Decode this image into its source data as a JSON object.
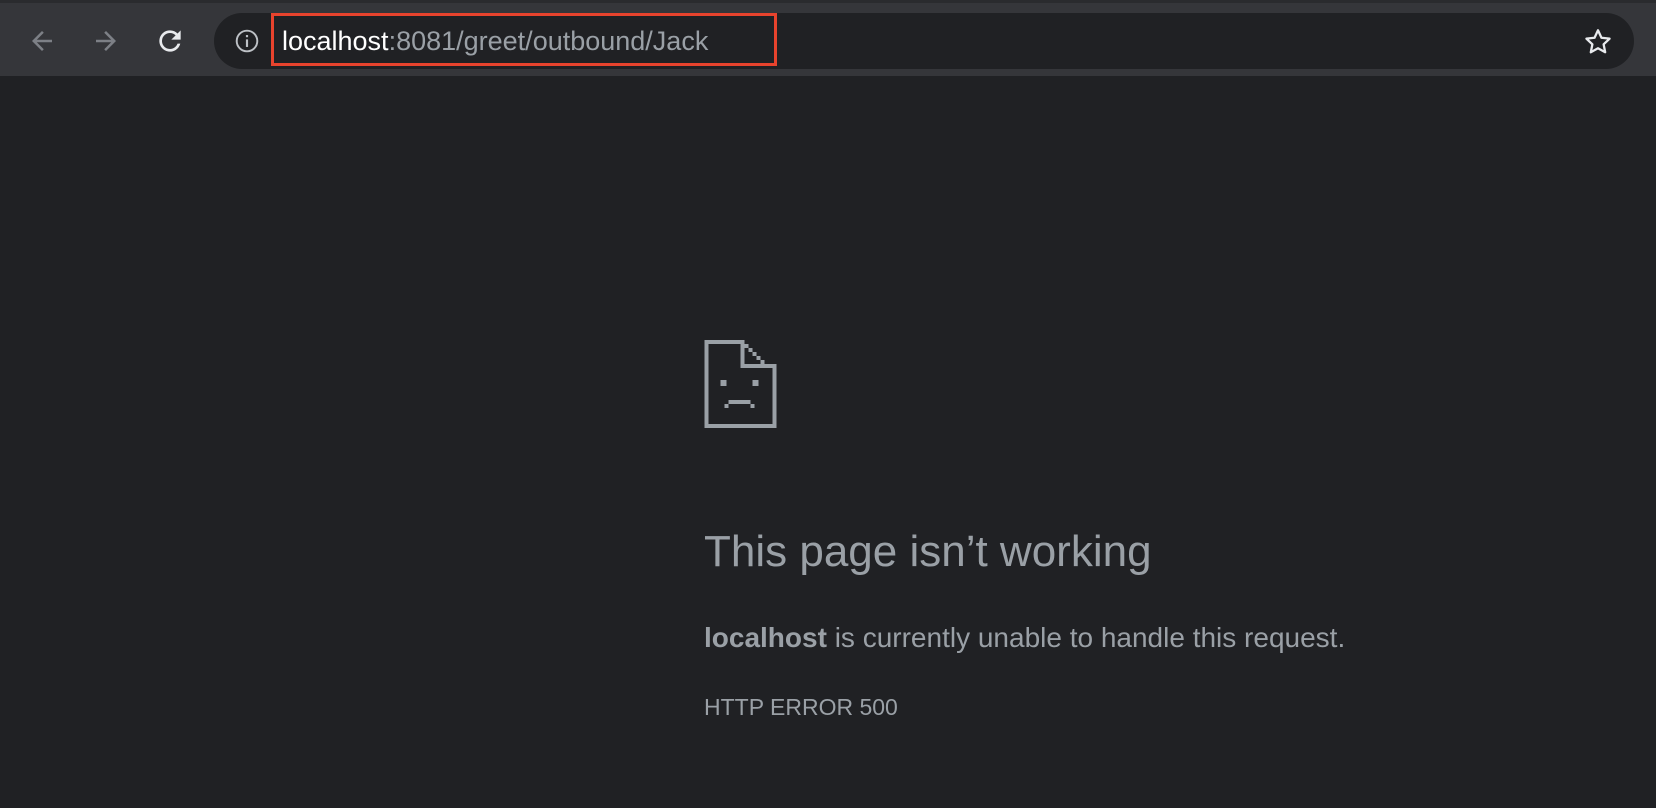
{
  "toolbar": {
    "back_icon": "arrow-left-icon",
    "forward_icon": "arrow-right-icon",
    "reload_icon": "reload-icon",
    "bookmark_icon": "star-icon"
  },
  "omnibox": {
    "site_info_icon": "info-icon",
    "url_host": "localhost",
    "url_path": ":8081/greet/outbound/Jack",
    "highlight_color": "#e8432d"
  },
  "error_page": {
    "icon": "sad-document-icon",
    "title": "This page isn’t working",
    "message_host": "localhost",
    "message_rest": " is currently unable to handle this request.",
    "error_code": "HTTP ERROR 500"
  },
  "colors": {
    "background": "#202124",
    "toolbar": "#35363a",
    "text": "#9aa0a6",
    "url_host": "#ffffff"
  }
}
